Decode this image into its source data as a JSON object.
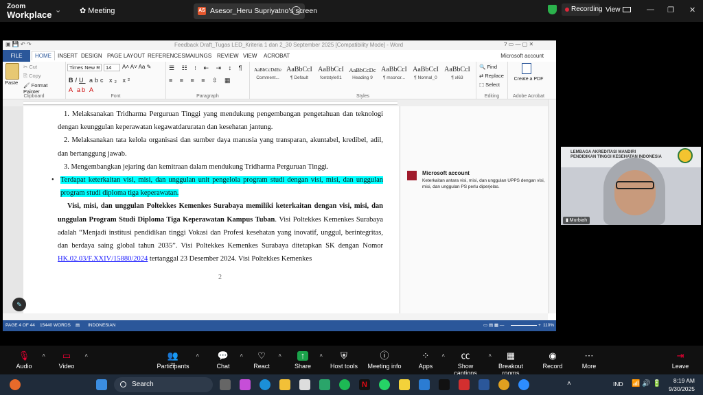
{
  "zoom": {
    "app_title": "Zoom",
    "app_subtitle": "Workplace",
    "meeting_label": "Meeting",
    "share_tab_title": "Asesor_Heru Supriyatno's screen",
    "share_badge": "AS",
    "recording_label": "Recording",
    "view_label": "View",
    "participant_name": "Murbiah",
    "participant_count": "21",
    "controls": [
      "Audio",
      "Video",
      "Participants",
      "Chat",
      "React",
      "Share",
      "Host tools",
      "Meeting info",
      "Apps",
      "Show captions",
      "Breakout rooms",
      "Record",
      "More",
      "Leave"
    ]
  },
  "word": {
    "title": "Feedback Draft_Tugas LED_Kriteria 1 dan 2_30 September 2025 [Compatibility Mode] - Word",
    "tabs": [
      "FILE",
      "HOME",
      "INSERT",
      "DESIGN",
      "PAGE LAYOUT",
      "REFERENCES",
      "MAILINGS",
      "REVIEW",
      "VIEW",
      "ACROBAT"
    ],
    "account": "Microsoft account",
    "ribbon": {
      "paste": "Paste",
      "cut": "Cut",
      "copy": "Copy",
      "format_painter": "Format Painter",
      "clipboard": "Clipboard",
      "font_name": "Times New R",
      "font_size": "14",
      "font": "Font",
      "paragraph": "Paragraph",
      "styles": "Styles",
      "editing": "Editing",
      "find": "Find",
      "replace": "Replace",
      "select": "Select",
      "create_pdf": "Create a PDF",
      "adobe": "Adobe Acrobat",
      "style_list": [
        {
          "preview": "AaBbCcDdEe",
          "name": "Comment..."
        },
        {
          "preview": "AaBbCcI",
          "name": "¶ Default"
        },
        {
          "preview": "AaBbCcI",
          "name": "fontstyle01"
        },
        {
          "preview": "AaBbCcDc",
          "name": "Heading 9"
        },
        {
          "preview": "AaBbCcI",
          "name": "¶ msonor..."
        },
        {
          "preview": "AaBbCcI",
          "name": "¶ Normal_0"
        },
        {
          "preview": "AaBbCcI",
          "name": "¶ xl63"
        }
      ]
    },
    "document": {
      "item1": "1. Melaksanakan Tridharma Perguruan Tinggi yang mendukung pengembangan pengetahuan dan teknologi dengan keunggulan keperawatan kegawatdaruratan dan kesehatan jantung.",
      "item2": "2. Melaksanakan tata kelola organisasi dan sumber daya manusia yang transparan, akuntabel, kredibel, adil, dan bertanggung jawab.",
      "item3": "3. Mengembangkan jejaring dan kemitraan dalam mendukung Tridharma Perguruan Tinggi.",
      "bullet_highlight": "Terdapat keterkaitan visi, misi, dan unggulan unit pengelola program studi dengan visi, misi, dan unggulan program studi diploma tiga keperawatan.",
      "bold_intro": "Visi, misi, dan unggulan Poltekkes Kemenkes Surabaya memiliki keterkaitan dengan visi, misi, dan unggulan Program Studi Diploma Tiga Keperawatan Kampus Tuban",
      "para_rest_a": ". Visi Poltekkes Kemenkes Surabaya adalah “Menjadi institusi pendidikan tinggi Vokasi dan Profesi kesehatan yang inovatif, unggul, berintegritas, dan berdaya saing global tahun 2035”. Visi Poltekkes Kemenkes Surabaya ditetapkan SK dengan Nomor ",
      "link": "HK.02.03/F.XXIV/15880/2024",
      "para_rest_b": " tertanggal 23 Desember 2024. Visi Poltekkes Kemenkes",
      "page_number": "2"
    },
    "comment": {
      "author": "Microsoft account",
      "text": "Keterkaitan antara visi, misi, dan unggulan UPPS dengan visi, misi, dan unggulan PS perlu diperjelas."
    },
    "status": {
      "page": "PAGE 4 OF 44",
      "words": "15440 WORDS",
      "language": "INDONESIAN",
      "zoom": "110%"
    }
  },
  "video_tile": {
    "org_line1": "LEMBAGA AKREDITASI MANDIRI",
    "org_line2": "PENDIDIKAN TINGGI KESEHATAN INDONESIA"
  },
  "taskbar": {
    "search": "Search",
    "language": "IND",
    "time": "8:19 AM",
    "date": "9/30/2025"
  }
}
